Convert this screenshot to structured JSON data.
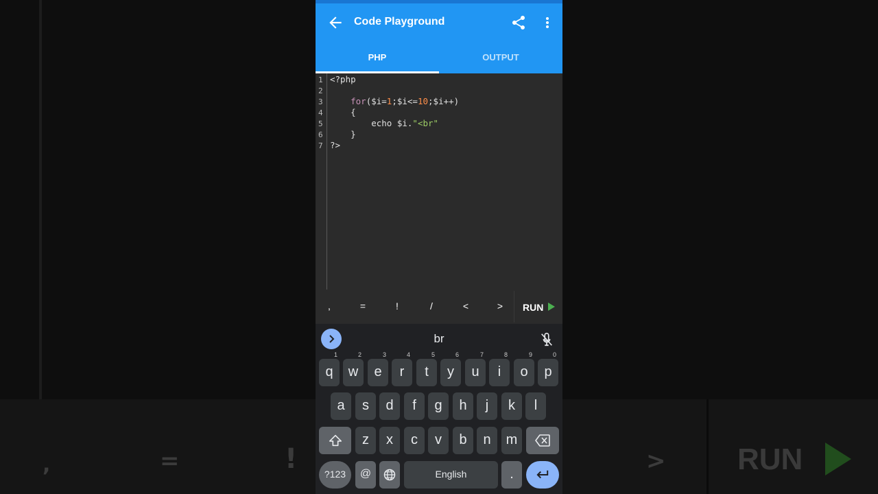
{
  "appbar": {
    "title": "Code Playground"
  },
  "tabs": [
    {
      "label": "PHP",
      "active": true
    },
    {
      "label": "OUTPUT",
      "active": false
    }
  ],
  "editor": {
    "line_numbers": [
      "1",
      "2",
      "3",
      "4",
      "5",
      "6",
      "7"
    ],
    "lines": [
      {
        "parts": [
          {
            "t": "<?php",
            "c": "plain"
          }
        ]
      },
      {
        "parts": []
      },
      {
        "parts": [
          {
            "t": "    for",
            "c": "kw"
          },
          {
            "t": "($i=",
            "c": "plain"
          },
          {
            "t": "1",
            "c": "num"
          },
          {
            "t": ";$i<=",
            "c": "plain"
          },
          {
            "t": "10",
            "c": "num"
          },
          {
            "t": ";$i++)",
            "c": "plain"
          }
        ]
      },
      {
        "parts": [
          {
            "t": "    {",
            "c": "plain"
          }
        ]
      },
      {
        "parts": [
          {
            "t": "        echo $i.",
            "c": "plain"
          },
          {
            "t": "\"<br\"",
            "c": "str"
          }
        ]
      },
      {
        "parts": [
          {
            "t": "    }",
            "c": "plain"
          }
        ]
      },
      {
        "parts": [
          {
            "t": "?>",
            "c": "plain"
          }
        ]
      }
    ]
  },
  "accessory": {
    "keys": [
      ",",
      "=",
      "!",
      "/",
      "<",
      ">"
    ],
    "run_label": "RUN"
  },
  "keyboard": {
    "suggestion": "br",
    "row1": [
      {
        "k": "q",
        "h": "1"
      },
      {
        "k": "w",
        "h": "2"
      },
      {
        "k": "e",
        "h": "3"
      },
      {
        "k": "r",
        "h": "4"
      },
      {
        "k": "t",
        "h": "5"
      },
      {
        "k": "y",
        "h": "6"
      },
      {
        "k": "u",
        "h": "7"
      },
      {
        "k": "i",
        "h": "8"
      },
      {
        "k": "o",
        "h": "9"
      },
      {
        "k": "p",
        "h": "0"
      }
    ],
    "row2": [
      "a",
      "s",
      "d",
      "f",
      "g",
      "h",
      "j",
      "k",
      "l"
    ],
    "row3": [
      "z",
      "x",
      "c",
      "v",
      "b",
      "n",
      "m"
    ],
    "sym_label": "?123",
    "at_label": "@",
    "space_label": "English",
    "period_label": "."
  },
  "background": {
    "keys": [
      ",",
      "=",
      "!",
      ">"
    ],
    "run_label": "RUN"
  },
  "colors": {
    "appbar": "#2196f3",
    "run_play": "#4caf50",
    "enter_key": "#8ab4f8",
    "keyword": "#c792b8",
    "number": "#ff8f4a",
    "string": "#9ccc65"
  }
}
